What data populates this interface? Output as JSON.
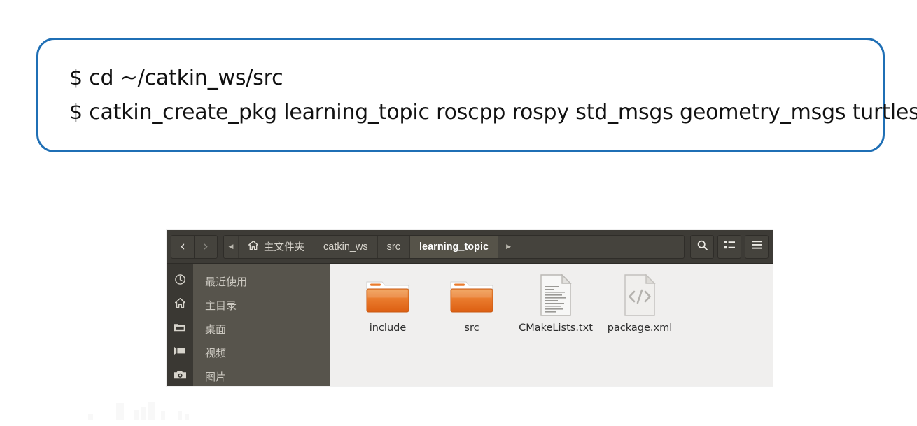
{
  "terminal_callout": {
    "border_color": "#1f6fb5",
    "lines": [
      "$ cd ~/catkin_ws/src",
      "$ catkin_create_pkg learning_topic roscpp rospy std_msgs geometry_msgs turtlesim"
    ]
  },
  "file_manager": {
    "toolbar": {
      "back_icon": "chevron-left-icon",
      "back_glyph": "‹",
      "forward_icon": "chevron-right-icon",
      "forward_glyph": "›",
      "crumb_scroll_glyph": "◀",
      "crumb_next_glyph": "▶",
      "search_label": "search-icon",
      "view_label": "list-view-icon",
      "menu_label": "hamburger-menu-icon"
    },
    "breadcrumbs": [
      {
        "label": "主文件夹",
        "icon": "home-icon",
        "active": false
      },
      {
        "label": "catkin_ws",
        "icon": "",
        "active": false
      },
      {
        "label": "src",
        "icon": "",
        "active": false
      },
      {
        "label": "learning_topic",
        "icon": "",
        "active": true
      }
    ],
    "sidebar": {
      "items": [
        {
          "label": "最近使用",
          "icon": "clock-icon"
        },
        {
          "label": "主目录",
          "icon": "home-icon"
        },
        {
          "label": "桌面",
          "icon": "folder-icon"
        },
        {
          "label": "视频",
          "icon": "video-icon"
        },
        {
          "label": "图片",
          "icon": "camera-icon"
        }
      ]
    },
    "files": [
      {
        "name": "include",
        "type": "folder",
        "icon": "folder-icon"
      },
      {
        "name": "src",
        "type": "folder",
        "icon": "folder-icon"
      },
      {
        "name": "CMakeLists.txt",
        "type": "text",
        "icon": "text-document-icon"
      },
      {
        "name": "package.xml",
        "type": "xml",
        "icon": "xml-document-icon"
      }
    ],
    "colors": {
      "toolbar_bg": "#3d3b36",
      "sidebar_icon_bg": "#3a3833",
      "sidebar_label_bg": "#57544c",
      "content_bg": "#f0efee",
      "folder_orange": "#e8702a"
    }
  }
}
